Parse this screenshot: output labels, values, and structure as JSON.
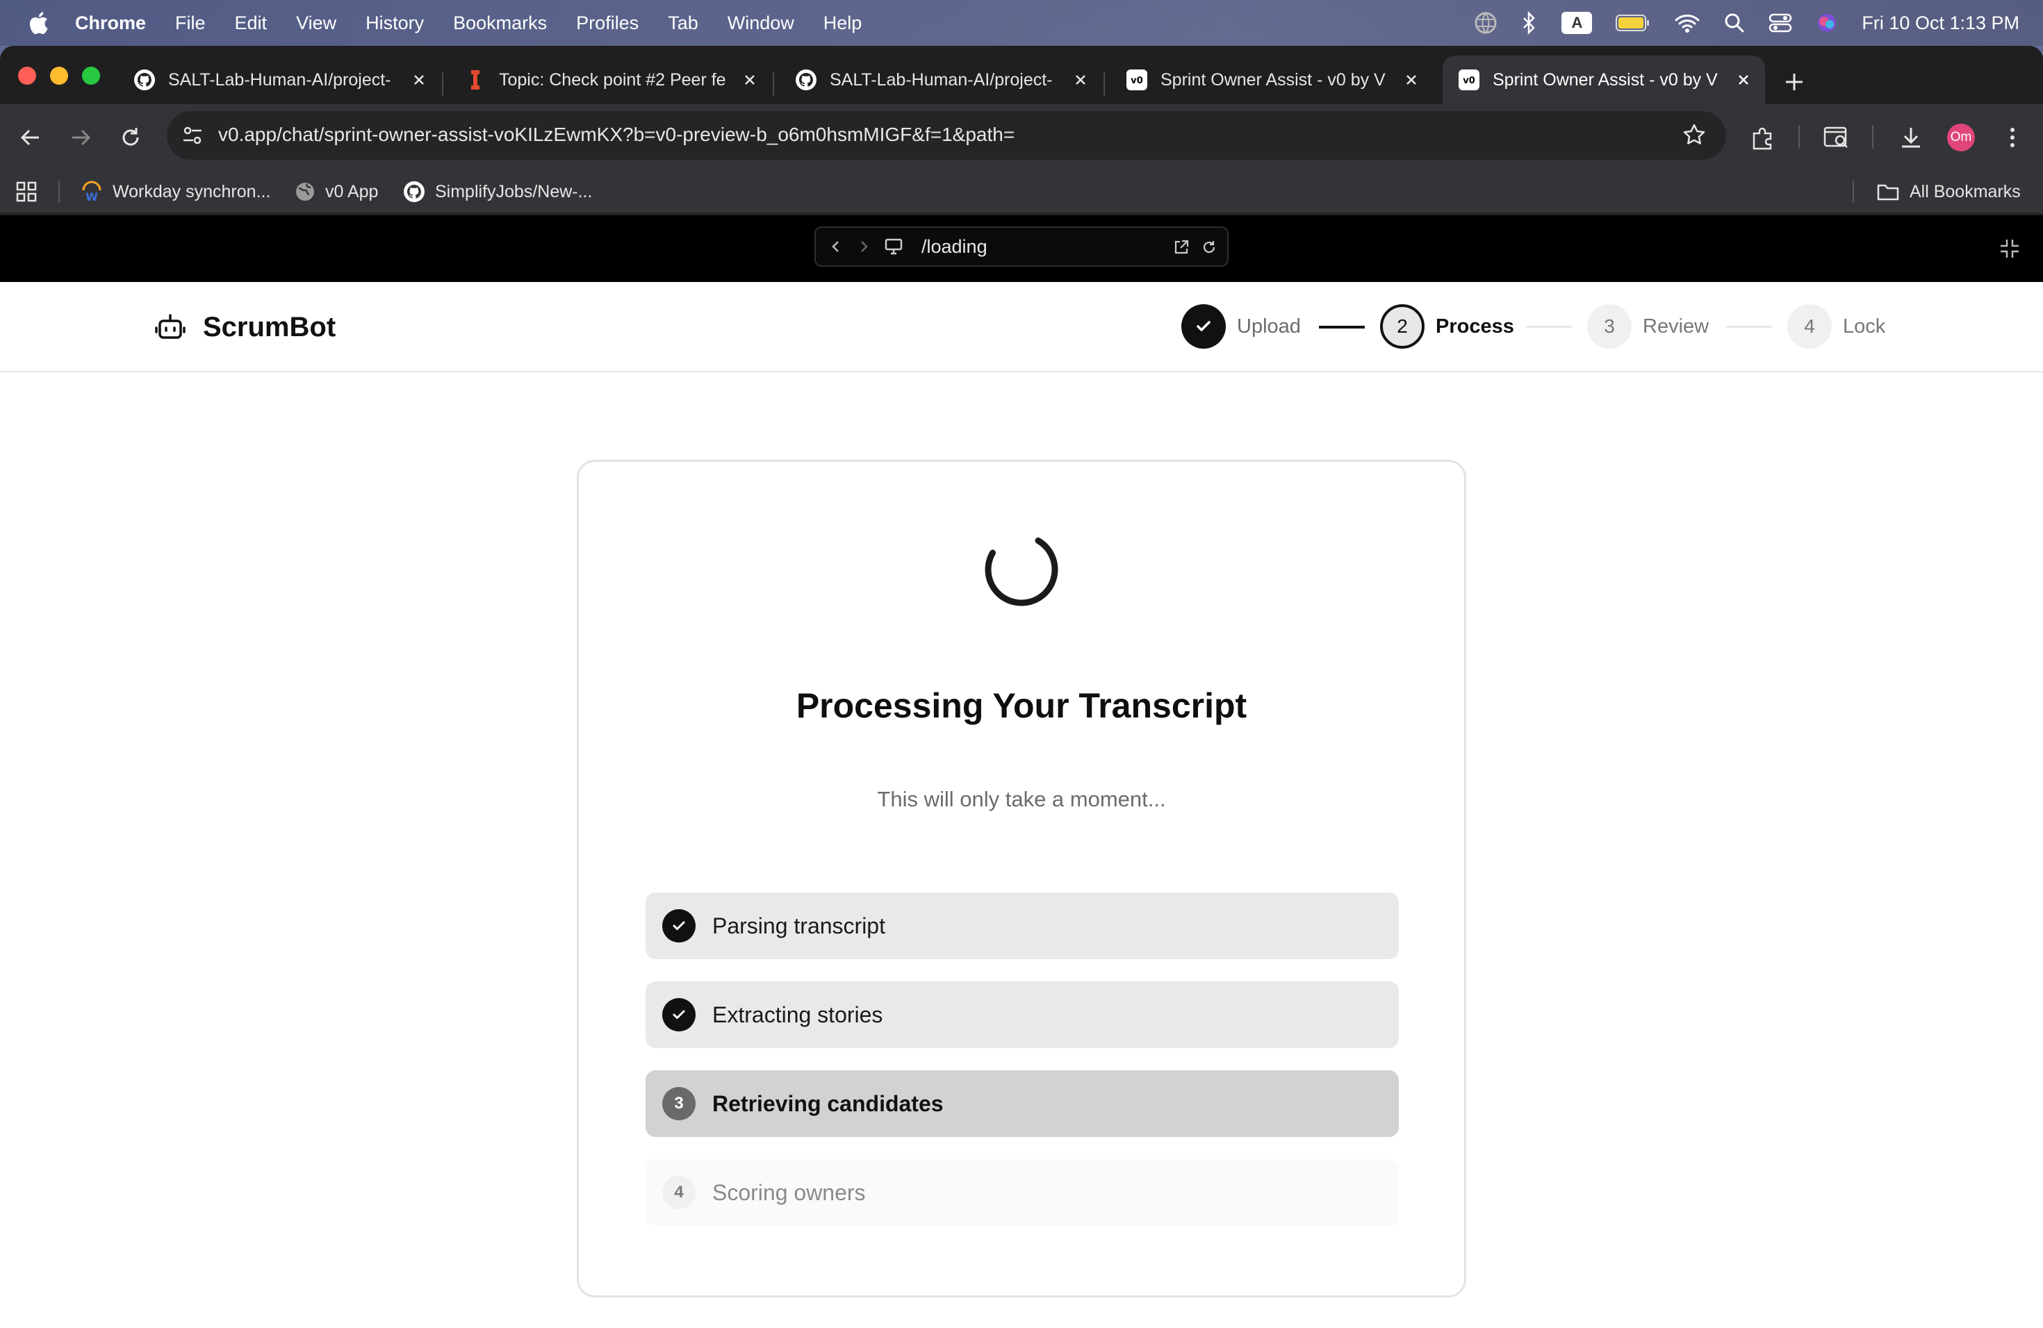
{
  "menubar": {
    "app_name": "Chrome",
    "menus": [
      "File",
      "Edit",
      "View",
      "History",
      "Bookmarks",
      "Profiles",
      "Tab",
      "Window",
      "Help"
    ],
    "input_source": "A",
    "datetime": "Fri 10 Oct  1:13 PM"
  },
  "tabs": [
    {
      "title": "SALT-Lab-Human-AI/project-",
      "icon": "github-icon"
    },
    {
      "title": "Topic: Check point #2 Peer fe",
      "icon": "instructure-icon"
    },
    {
      "title": "SALT-Lab-Human-AI/project-",
      "icon": "github-icon"
    },
    {
      "title": "Sprint Owner Assist - v0 by V",
      "icon": "v0-icon"
    },
    {
      "title": "Sprint Owner Assist - v0 by V",
      "icon": "v0-icon",
      "active": true
    }
  ],
  "address_bar": {
    "url": "v0.app/chat/sprint-owner-assist-voKILzEwmKX?b=v0-preview-b_o6m0hsmMIGF&f=1&path="
  },
  "profile": {
    "initials": "Om",
    "color": "#e0457b"
  },
  "bookmarks": {
    "items": [
      {
        "label": "Workday synchron...",
        "icon": "workday-icon"
      },
      {
        "label": "v0 App",
        "icon": "globe-icon"
      },
      {
        "label": "SimplifyJobs/New-...",
        "icon": "github-icon"
      }
    ],
    "all_label": "All Bookmarks"
  },
  "preview": {
    "path": "/loading"
  },
  "app": {
    "brand": "ScrumBot",
    "steps": [
      {
        "number": "1",
        "label": "Upload",
        "status": "done"
      },
      {
        "number": "2",
        "label": "Process",
        "status": "current"
      },
      {
        "number": "3",
        "label": "Review",
        "status": "pending"
      },
      {
        "number": "4",
        "label": "Lock",
        "status": "pending"
      }
    ]
  },
  "card": {
    "title": "Processing Your Transcript",
    "subtitle": "This will only take a moment...",
    "steps": [
      {
        "number": "1",
        "label": "Parsing transcript",
        "status": "done"
      },
      {
        "number": "2",
        "label": "Extracting stories",
        "status": "done"
      },
      {
        "number": "3",
        "label": "Retrieving candidates",
        "status": "active"
      },
      {
        "number": "4",
        "label": "Scoring owners",
        "status": "pending"
      }
    ]
  },
  "colors": {
    "accent": "#111111",
    "done_row_bg": "#e9e9e9",
    "active_row_bg": "#d2d2d2",
    "pending_row_bg": "#fafafa"
  }
}
